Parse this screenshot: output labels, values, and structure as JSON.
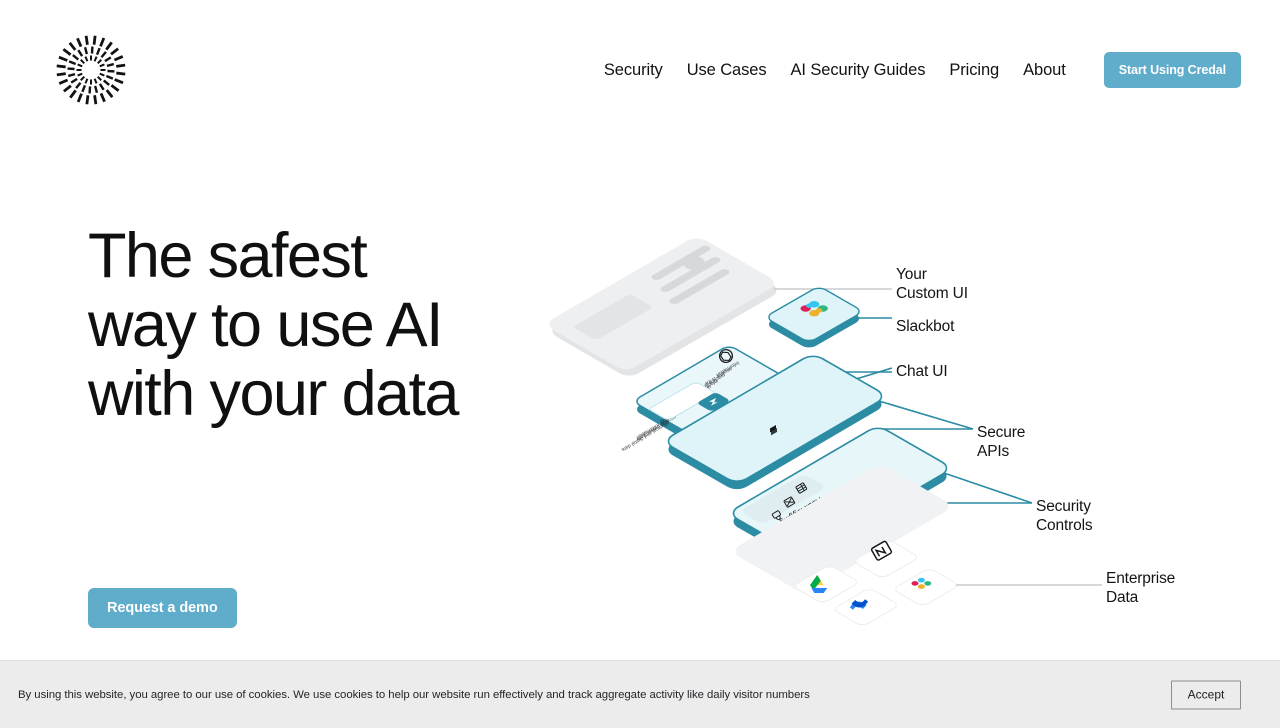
{
  "header": {
    "logo_name": "credal-sunburst-logo",
    "nav": [
      {
        "label": "Security"
      },
      {
        "label": "Use Cases"
      },
      {
        "label": "AI Security Guides"
      },
      {
        "label": "Pricing"
      },
      {
        "label": "About"
      }
    ],
    "cta_label": "Start Using Credal",
    "cta_color": "#5FACCB"
  },
  "hero": {
    "title_lines": [
      "The safest",
      "way to use AI",
      "with your data"
    ],
    "demo_label": "Request a demo",
    "demo_color": "#5FACCB"
  },
  "illustration": {
    "accent_color": "#2B8CA3",
    "card_fill": "#DFF4F8",
    "gray_card_fill": "#EDEEEF",
    "labels": [
      {
        "name": "your-custom-ui",
        "text": "Your\nCustom UI",
        "line_color": "#c9cccd"
      },
      {
        "name": "slackbot",
        "text": "Slackbot",
        "line_color": "#2B8CA3"
      },
      {
        "name": "chat-ui",
        "text": "Chat UI",
        "line_color": "#2B8CA3"
      },
      {
        "name": "secure-apis",
        "text": "Secure\nAPIs",
        "line_color": "#2B8CA3"
      },
      {
        "name": "security-controls",
        "text": "Security\nControls",
        "line_color": "#2B8CA3"
      },
      {
        "name": "enterprise-data",
        "text": "Enterprise\nData",
        "line_color": "#c9cccd"
      }
    ],
    "chat_card_paragraph": "Information security is the practice of protecting information from unauthorized access, use, disclosure, disruption, modification, or destruction. Information security covers both physical and digital data",
    "security_controls_items": [
      {
        "icon": "audit-log-icon",
        "label": "Audit logging"
      },
      {
        "icon": "redaction-icon",
        "label": "Redaction"
      },
      {
        "icon": "access-controls-lock-icon",
        "label": "Access Controls"
      }
    ],
    "data_source_icons": [
      "notion-icon",
      "google-drive-icon",
      "confluence-icon",
      "slack-icon"
    ]
  },
  "cookie_banner": {
    "message": "By using this website, you agree to our use of cookies. We use cookies to help our website run effectively and  track aggregate activity like daily visitor numbers",
    "accept_label": "Accept"
  }
}
